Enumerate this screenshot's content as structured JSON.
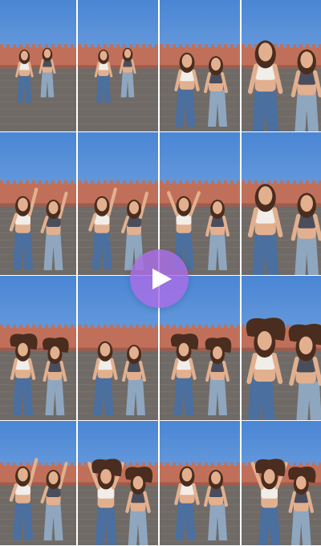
{
  "frames": [
    {
      "scene": "wide-walk"
    },
    {
      "scene": "wide-walk"
    },
    {
      "scene": "pose-mid"
    },
    {
      "scene": "close-pose"
    },
    {
      "scene": "arm-raise"
    },
    {
      "scene": "arm-raise"
    },
    {
      "scene": "hands-up"
    },
    {
      "scene": "close-pose"
    },
    {
      "scene": "hair-toss"
    },
    {
      "scene": "pose-mid"
    },
    {
      "scene": "hair-toss"
    },
    {
      "scene": "close-turn"
    },
    {
      "scene": "arm-raise"
    },
    {
      "scene": "spin"
    },
    {
      "scene": "pose-mid"
    },
    {
      "scene": "spin"
    }
  ],
  "colors": {
    "sky_top": "#4a86d4",
    "sky_bottom": "#8fb6e6",
    "wall": "#c0705a",
    "wall_dark": "#a35a48",
    "pavement": "#6f6a66",
    "pavement_light": "#8a8580",
    "jeans": "#4b6f9e",
    "jeans_light": "#8fa6bf",
    "top_white": "#f1ede8",
    "top_dark": "#4a4e5c",
    "skin": "#e2b08f",
    "hair": "#4a2d1e",
    "play_accent": "#aa6ee6"
  },
  "play_icon": "play-icon"
}
